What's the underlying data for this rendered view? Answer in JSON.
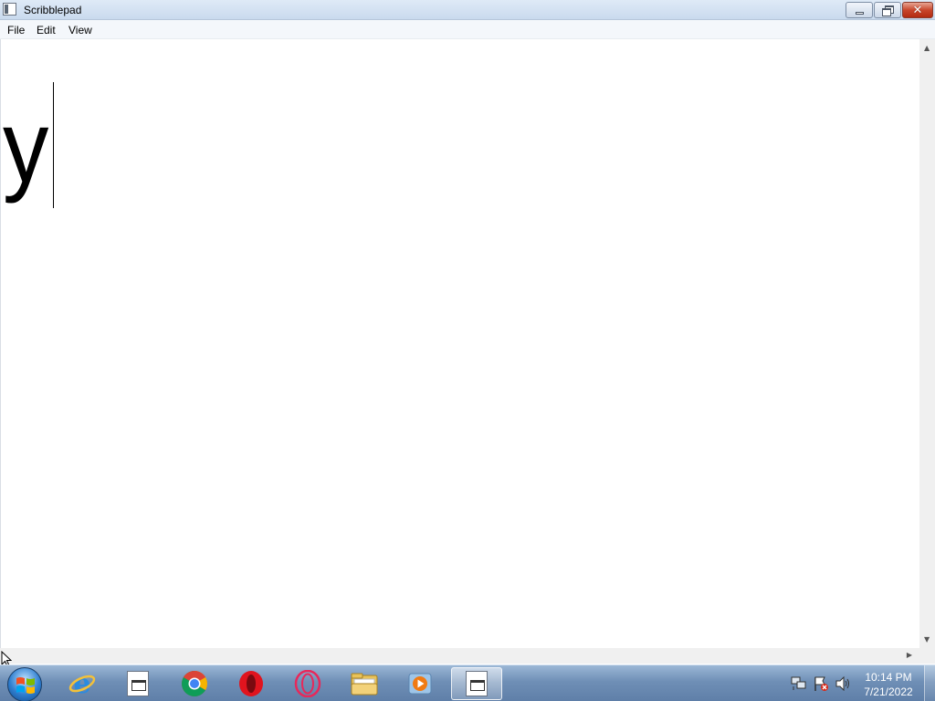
{
  "window": {
    "title": "Scribblepad"
  },
  "menu": {
    "file": "File",
    "edit": "Edit",
    "view": "View"
  },
  "editor": {
    "content": "y"
  },
  "taskbar": {
    "apps": [
      {
        "name": "internet-explorer-icon"
      },
      {
        "name": "document-icon"
      },
      {
        "name": "chrome-icon"
      },
      {
        "name": "opera-icon"
      },
      {
        "name": "opera-gx-icon"
      },
      {
        "name": "file-explorer-icon"
      },
      {
        "name": "media-player-icon"
      },
      {
        "name": "scribblepad-icon",
        "active": true
      }
    ],
    "clock": {
      "time": "10:14 PM",
      "date": "7/21/2022"
    }
  },
  "colors": {
    "titlebar": "#c9daee",
    "close_button": "#c8462c",
    "taskbar": "#6f8fb6"
  }
}
